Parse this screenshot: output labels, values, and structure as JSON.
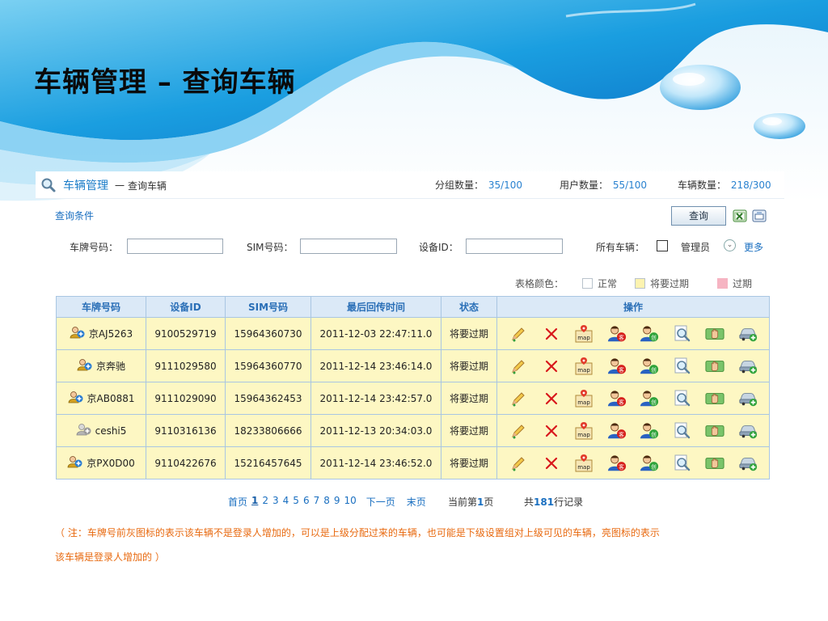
{
  "slide": {
    "title": "车辆管理 – 查询车辆"
  },
  "breadcrumb": {
    "main": "车辆管理",
    "separator": "一",
    "sub": "查询车辆"
  },
  "stats": {
    "groups_label": "分组数量：",
    "groups_value": "35/100",
    "users_label": "用户数量：",
    "users_value": "55/100",
    "vehicles_label": "车辆数量：",
    "vehicles_value": "218/300"
  },
  "query": {
    "section_label": "查询条件",
    "button_label": "查询",
    "plate_label": "车牌号码：",
    "plate_value": "",
    "sim_label": "SIM号码：",
    "sim_value": "",
    "device_label": "设备ID：",
    "device_value": "",
    "all_vehicles_label": "所有车辆：",
    "admin_label": "管理员",
    "more_label": "更多"
  },
  "legend": {
    "label": "表格颜色：",
    "items": [
      {
        "label": "正常",
        "color": "#ffffff"
      },
      {
        "label": "将要过期",
        "color": "#fdf3b0"
      },
      {
        "label": "过期",
        "color": "#f6b4c2"
      }
    ]
  },
  "table": {
    "headers": [
      "车牌号码",
      "设备ID",
      "SIM号码",
      "最后回传时间",
      "状态",
      "操作"
    ],
    "rows": [
      {
        "plate": "京AJ5263",
        "device": "9100529719",
        "sim": "15964360730",
        "time": "2011-12-03 22:47:11.0",
        "status": "将要过期",
        "own": true
      },
      {
        "plate": "京奔驰",
        "device": "9111029580",
        "sim": "15964360770",
        "time": "2011-12-14 23:46:14.0",
        "status": "将要过期",
        "own": true
      },
      {
        "plate": "京AB0881",
        "device": "9111029090",
        "sim": "15964362453",
        "time": "2011-12-14 23:42:57.0",
        "status": "将要过期",
        "own": true
      },
      {
        "plate": "ceshi5",
        "device": "9110316136",
        "sim": "18233806666",
        "time": "2011-12-13 20:34:03.0",
        "status": "将要过期",
        "own": false
      },
      {
        "plate": "京PX0D00",
        "device": "9110422676",
        "sim": "15216457645",
        "time": "2011-12-14 23:46:52.0",
        "status": "将要过期",
        "own": true
      }
    ],
    "operation_icons": [
      "edit-icon",
      "delete-icon",
      "map-icon",
      "customer-icon",
      "create-icon",
      "search-icon",
      "hand-icon",
      "vehicle-add-icon"
    ]
  },
  "pager": {
    "first": "首页",
    "pages": [
      "1",
      "2",
      "3",
      "4",
      "5",
      "6",
      "7",
      "8",
      "9",
      "10"
    ],
    "current_page": "1",
    "next": "下一页",
    "last": "末页",
    "current_prefix": "当前第",
    "current_value": "1",
    "current_suffix": "页",
    "total_prefix": "共",
    "total_value": "181",
    "total_suffix": "行记录"
  },
  "note": {
    "line1": "（ 注：车牌号前灰图标的表示该车辆不是登录人增加的，可以是上级分配过来的车辆，也可能是下级设置组对上级可见的车辆，亮图标的表示",
    "line2": "该车辆是登录人增加的 ）"
  }
}
